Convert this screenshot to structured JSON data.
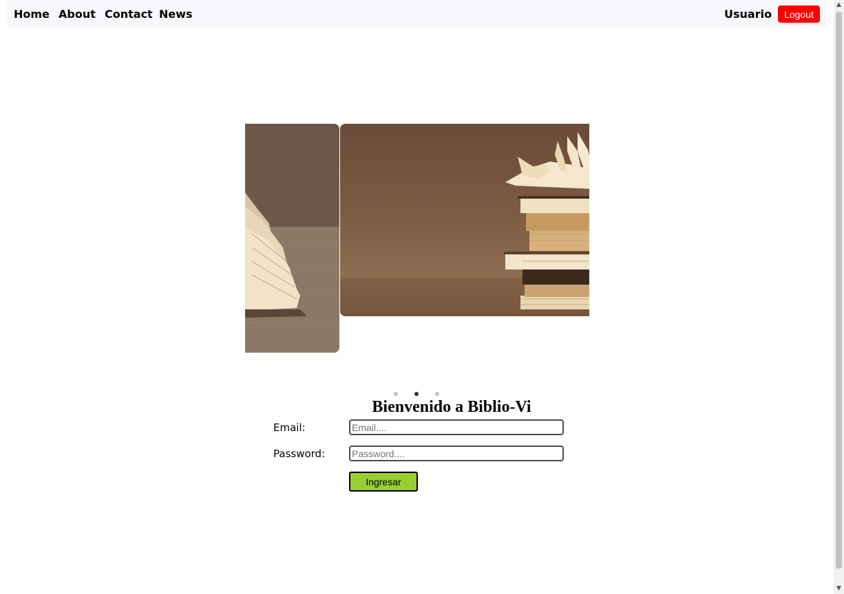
{
  "nav": {
    "home": "Home",
    "about": "About",
    "contact": "Contact",
    "news": "News",
    "user": "Usuario",
    "logout": "Logout"
  },
  "carousel": {
    "slide_count": 3,
    "active_slide": 2
  },
  "login": {
    "title": "Bienvenido a Biblio-Vi",
    "email_label": "Email:",
    "email_placeholder": "Email....",
    "email_value": "",
    "password_label": "Password:",
    "password_placeholder": "Password....",
    "password_value": "",
    "submit_label": "Ingresar"
  },
  "colors": {
    "navbar_bg": "#f7f8fc",
    "logout_bg": "#ff0000",
    "submit_bg": "#9acd32"
  },
  "icons": {
    "scroll_up": "▲",
    "scroll_down": "▼"
  }
}
